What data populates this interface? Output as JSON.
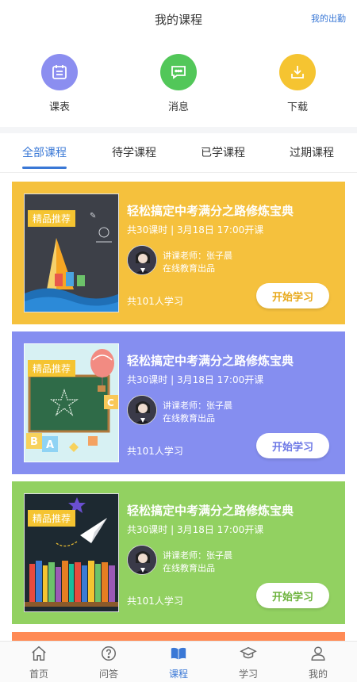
{
  "header": {
    "title": "我的课程",
    "attendance_link": "我的出勤"
  },
  "quick_actions": [
    {
      "label": "课表",
      "icon": "calendar-icon",
      "color": "#8b8ef0"
    },
    {
      "label": "消息",
      "icon": "message-icon",
      "color": "#52c759"
    },
    {
      "label": "下载",
      "icon": "download-icon",
      "color": "#f5c431"
    }
  ],
  "tabs": [
    {
      "label": "全部课程",
      "active": true
    },
    {
      "label": "待学课程",
      "active": false
    },
    {
      "label": "已学课程",
      "active": false
    },
    {
      "label": "过期课程",
      "active": false
    }
  ],
  "courses": [
    {
      "badge": "精品推荐",
      "title": "轻松搞定中考满分之路修炼宝典",
      "meta": "共30课时 | 3月18日 17:00开课",
      "teacher": "讲课老师：张子晨",
      "publisher": "在线教育出品",
      "learners": "共101人学习",
      "button": "开始学习",
      "bg": "#f5c13d",
      "button_color": "#e8a91c"
    },
    {
      "badge": "精品推荐",
      "title": "轻松搞定中考满分之路修炼宝典",
      "meta": "共30课时 | 3月18日 17:00开课",
      "teacher": "讲课老师：张子晨",
      "publisher": "在线教育出品",
      "learners": "共101人学习",
      "button": "开始学习",
      "bg": "#858ef0",
      "button_color": "#6d78e6"
    },
    {
      "badge": "精品推荐",
      "title": "轻松搞定中考满分之路修炼宝典",
      "meta": "共30课时 | 3月18日 17:00开课",
      "teacher": "讲课老师：张子晨",
      "publisher": "在线教育出品",
      "learners": "共101人学习",
      "button": "开始学习",
      "bg": "#92d161",
      "button_color": "#6db33d"
    }
  ],
  "bottom_nav": [
    {
      "label": "首页",
      "icon": "home-icon",
      "active": false
    },
    {
      "label": "问答",
      "icon": "question-icon",
      "active": false
    },
    {
      "label": "课程",
      "icon": "book-icon",
      "active": true
    },
    {
      "label": "学习",
      "icon": "graduation-cap-icon",
      "active": false
    },
    {
      "label": "我的",
      "icon": "user-icon",
      "active": false
    }
  ],
  "colors": {
    "accent": "#3a78d6"
  }
}
